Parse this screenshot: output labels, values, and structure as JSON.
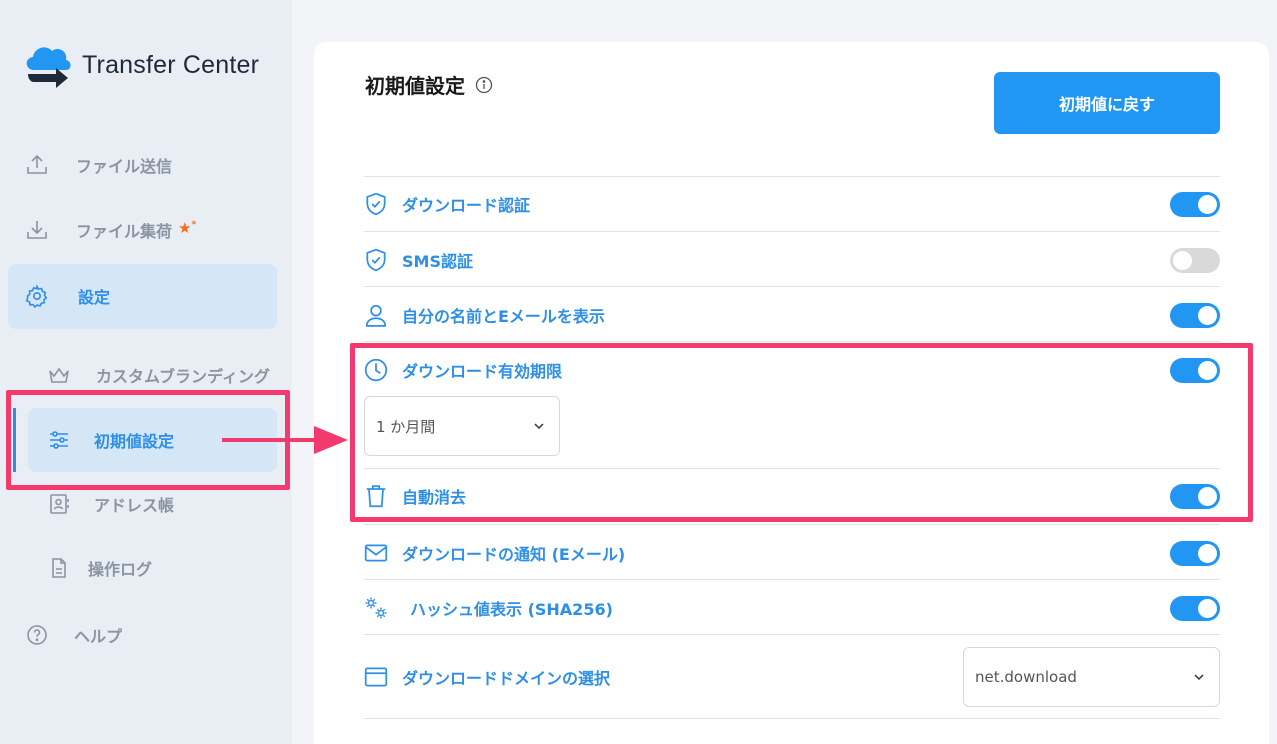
{
  "app": {
    "name": "Transfer Center"
  },
  "sidebar": {
    "items": [
      {
        "label": "ファイル送信",
        "icon": "upload-icon"
      },
      {
        "label": "ファイル集荷",
        "icon": "download-icon",
        "badge": "new-star"
      },
      {
        "label": "設定",
        "icon": "gear-icon"
      }
    ],
    "sub_items": [
      {
        "label": "カスタムブランディング",
        "icon": "crown-icon"
      },
      {
        "label": "初期値設定",
        "icon": "sliders-icon"
      },
      {
        "label": "アドレス帳",
        "icon": "address-book-icon"
      },
      {
        "label": "操作ログ",
        "icon": "document-icon"
      }
    ],
    "help": {
      "label": "ヘルプ",
      "icon": "help-icon"
    }
  },
  "page": {
    "title": "初期値設定",
    "reset_button": "初期値に戻す"
  },
  "settings": [
    {
      "label": "ダウンロード認証",
      "icon": "shield-check-icon",
      "enabled": true
    },
    {
      "label": "SMS認証",
      "icon": "shield-check-icon",
      "enabled": false
    },
    {
      "label": "自分の名前とEメールを表示",
      "icon": "user-icon",
      "enabled": true
    },
    {
      "label": "ダウンロード有効期限",
      "icon": "clock-icon",
      "enabled": true
    },
    {
      "label": "自動消去",
      "icon": "trash-icon",
      "enabled": true
    },
    {
      "label": "ダウンロードの通知 (Eメール)",
      "icon": "mail-icon",
      "enabled": true
    },
    {
      "label": "ハッシュ値表示 (SHA256)",
      "icon": "gears-icon",
      "enabled": true
    },
    {
      "label": "ダウンロードドメインの選択",
      "icon": "browser-window-icon"
    }
  ],
  "expiry_select": {
    "value": "1 か月間"
  },
  "domain_select": {
    "value": "net.download"
  },
  "colors": {
    "accent": "#2196f3",
    "highlight": "#f23a6e",
    "sidebar_bg": "#e9eef5",
    "active_bg": "#d5e7f7"
  }
}
